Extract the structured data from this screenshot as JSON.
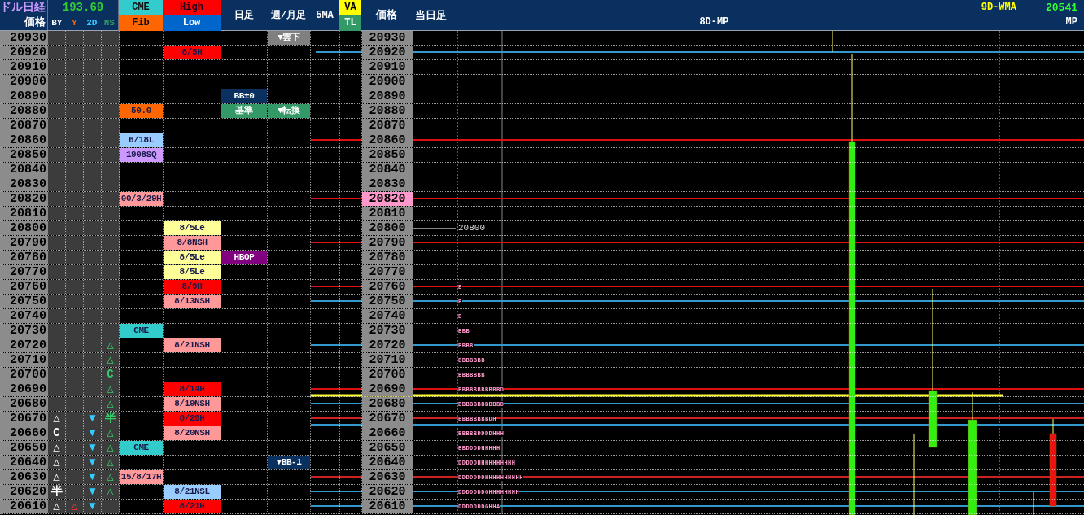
{
  "header": {
    "title": "ドル日経",
    "rate": "193.69",
    "price_label": "価格",
    "sub_columns": [
      "BY",
      "Y",
      "2D",
      "NS"
    ],
    "fib_top": "CME",
    "fib_bottom": "Fib",
    "hl_top": "High",
    "hl_bottom": "Low",
    "daily": "日足",
    "weekly": "週/月足",
    "ma": "5MA",
    "va": "VA",
    "tl": "TL",
    "price2": "価格",
    "today": "当日足",
    "mp8": "8D-MP",
    "wma_label": "9D-WMA",
    "wma_value": "20541",
    "mp": "MP"
  },
  "rows": [
    {
      "price": "20930",
      "weekly": {
        "text": "▼雲下",
        "color": "#808080"
      },
      "price2": "20930",
      "highlighted": false
    },
    {
      "price": "20920",
      "hl": {
        "text": "8/5H",
        "color": "#ff0000"
      },
      "price2": "20920",
      "highlighted": false
    },
    {
      "price": "20910",
      "price2": "20910",
      "highlighted": false
    },
    {
      "price": "20900",
      "price2": "20900",
      "highlighted": false
    },
    {
      "price": "20890",
      "daily": {
        "text": "BB±0",
        "color": "#0a3060"
      },
      "price2": "20890",
      "highlighted": false
    },
    {
      "price": "20880",
      "fib": {
        "text": "50.0",
        "color": "#ff6600"
      },
      "daily": {
        "text": "基準",
        "color": "#339966"
      },
      "weekly": {
        "text": "▼転換",
        "color": "#339966"
      },
      "price2": "20880",
      "highlighted": false
    },
    {
      "price": "20870",
      "price2": "20870",
      "highlighted": false
    },
    {
      "price": "20860",
      "fib": {
        "text": "6/18L",
        "color": "#99ccff"
      },
      "price2": "20860",
      "highlighted": false
    },
    {
      "price": "20850",
      "fib": {
        "text": "1908SQ",
        "color": "#cc99ff"
      },
      "price2": "20850",
      "highlighted": false
    },
    {
      "price": "20840",
      "price2": "20840",
      "highlighted": false
    },
    {
      "price": "20830",
      "price2": "20830",
      "highlighted": false
    },
    {
      "price": "20820",
      "fib": {
        "text": "00/3/29H",
        "color": "#ff9999"
      },
      "price2": "20820",
      "highlighted": true
    },
    {
      "price": "20810",
      "price2": "20810",
      "highlighted": false
    },
    {
      "price": "20800",
      "hl": {
        "text": "8/5Le",
        "color": "#ffff99"
      },
      "price2": "20800",
      "highlighted": false,
      "marker": "20800"
    },
    {
      "price": "20790",
      "hl": {
        "text": "8/8NSH",
        "color": "#ff9999"
      },
      "price2": "20790",
      "highlighted": false
    },
    {
      "price": "20780",
      "hl": {
        "text": "8/5Le",
        "color": "#ffff99"
      },
      "daily": {
        "text": "HBOP",
        "color": "#800080"
      },
      "price2": "20780",
      "highlighted": false
    },
    {
      "price": "20770",
      "hl": {
        "text": "8/5Le",
        "color": "#ffff99"
      },
      "price2": "20770",
      "highlighted": false
    },
    {
      "price": "20760",
      "hl": {
        "text": "8/9H",
        "color": "#ff0000"
      },
      "price2": "20760",
      "highlighted": false,
      "profile": "B"
    },
    {
      "price": "20750",
      "hl": {
        "text": "8/13NSH",
        "color": "#ff9999"
      },
      "price2": "20750",
      "highlighted": false,
      "profile": "B"
    },
    {
      "price": "20740",
      "price2": "20740",
      "highlighted": false,
      "profile": "B"
    },
    {
      "price": "20730",
      "fib": {
        "text": "CME",
        "color": "#33cccc"
      },
      "price2": "20730",
      "highlighted": false,
      "profile": "BBB"
    },
    {
      "price": "20720",
      "ns": "△",
      "hl": {
        "text": "8/21NSH",
        "color": "#ff9999"
      },
      "price2": "20720",
      "highlighted": false,
      "profile": "BBBB"
    },
    {
      "price": "20710",
      "ns": "△",
      "price2": "20710",
      "highlighted": false,
      "profile": "BBBBBBB"
    },
    {
      "price": "20700",
      "ns": "C",
      "price2": "20700",
      "highlighted": false,
      "profile": "BBBBBBB"
    },
    {
      "price": "20690",
      "ns": "△",
      "hl": {
        "text": "8/14H",
        "color": "#ff0000"
      },
      "price2": "20690",
      "highlighted": false,
      "profile": "BBBBBBBBBBBD"
    },
    {
      "price": "20680",
      "ns": "△",
      "hl": {
        "text": "8/19NSH",
        "color": "#ff9999"
      },
      "price2": "20680",
      "highlighted": false,
      "profile": "BBBBBBBBBBBD"
    },
    {
      "price": "20670",
      "by": "△",
      "d2": "▼",
      "ns": "半",
      "hl": {
        "text": "8/20H",
        "color": "#ff0000"
      },
      "price2": "20670",
      "highlighted": false,
      "profile": "BBBBBBBBDH"
    },
    {
      "price": "20660",
      "by": "C",
      "d2": "▼",
      "ns": "△",
      "hl": {
        "text": "8/20NSH",
        "color": "#ff9999"
      },
      "price2": "20660",
      "highlighted": false,
      "profile": "BBBBBDDDDHHH"
    },
    {
      "price": "20650",
      "by": "△",
      "d2": "▼",
      "ns": "△",
      "fib": {
        "text": "CME",
        "color": "#33cccc"
      },
      "price2": "20650",
      "highlighted": false,
      "profile": "BBDDDDHHHHH"
    },
    {
      "price": "20640",
      "by": "△",
      "d2": "▼",
      "ns": "△",
      "weekly": {
        "text": "▼BB-1",
        "color": "#0a3060"
      },
      "price2": "20640",
      "highlighted": false,
      "profile": "DDDDDHHHHHHHHHH"
    },
    {
      "price": "20630",
      "by": "△",
      "d2": "▼",
      "ns": "△",
      "fib": {
        "text": "15/8/17H",
        "color": "#ff9999"
      },
      "price2": "20630",
      "highlighted": false,
      "profile": "DDDDDDDHHHHHHHHHH"
    },
    {
      "price": "20620",
      "by": "半",
      "d2": "▼",
      "ns": "△",
      "hl": {
        "text": "8/21NSL",
        "color": "#99ccff"
      },
      "price2": "20620",
      "highlighted": false,
      "profile": "DDDDDDDGHHHHHHHH"
    },
    {
      "price": "20610",
      "by": "△",
      "y": "△",
      "d2": "▼",
      "hl": {
        "text": "8/21H",
        "color": "#ff0000"
      },
      "price2": "20610",
      "highlighted": false,
      "profile": "DDDDDDDGHHA"
    }
  ]
}
